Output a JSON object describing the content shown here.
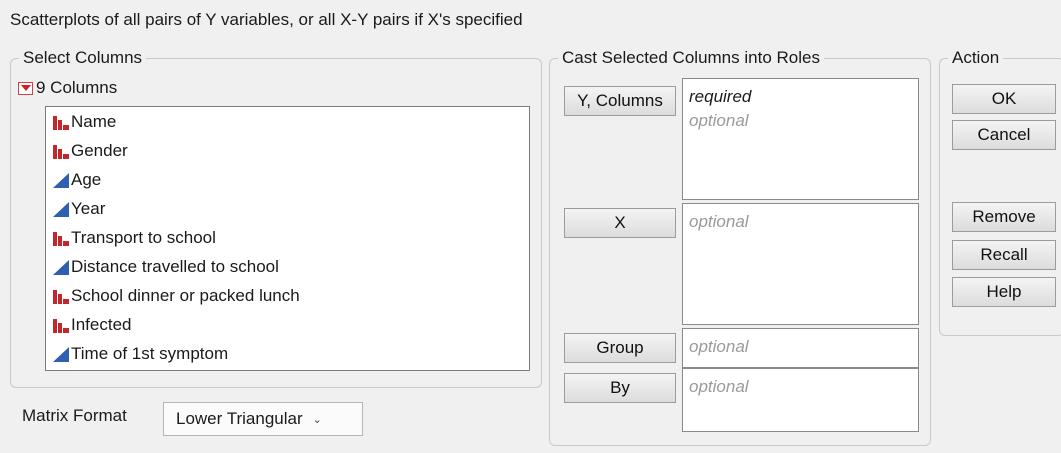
{
  "title": "Scatterplots of all pairs of Y variables, or all X-Y pairs if X's specified",
  "select_columns": {
    "label": "Select Columns",
    "header": "9 Columns",
    "items": [
      {
        "name": "Name",
        "icon": "nominal-bar-icon"
      },
      {
        "name": "Gender",
        "icon": "nominal-bar-icon"
      },
      {
        "name": "Age",
        "icon": "continuous-triangle-icon"
      },
      {
        "name": "Year",
        "icon": "continuous-triangle-icon"
      },
      {
        "name": "Transport to school",
        "icon": "nominal-bar-icon"
      },
      {
        "name": "Distance travelled to school",
        "icon": "continuous-triangle-icon"
      },
      {
        "name": "School dinner or packed lunch",
        "icon": "nominal-bar-icon"
      },
      {
        "name": "Infected",
        "icon": "nominal-bar-icon"
      },
      {
        "name": "Time of 1st symptom",
        "icon": "continuous-triangle-icon"
      }
    ]
  },
  "matrix_format": {
    "label": "Matrix Format",
    "value": "Lower Triangular"
  },
  "cast_roles": {
    "label": "Cast Selected Columns into Roles",
    "roles": {
      "y": {
        "button": "Y, Columns",
        "required": "required",
        "optional": "optional"
      },
      "x": {
        "button": "X",
        "optional": "optional"
      },
      "group": {
        "button": "Group",
        "optional": "optional"
      },
      "by": {
        "button": "By",
        "optional": "optional"
      }
    }
  },
  "action": {
    "label": "Action",
    "ok": "OK",
    "cancel": "Cancel",
    "remove": "Remove",
    "recall": "Recall",
    "help": "Help"
  },
  "colors": {
    "nominal": "#c0282c",
    "continuous": "#2e5fb0"
  }
}
